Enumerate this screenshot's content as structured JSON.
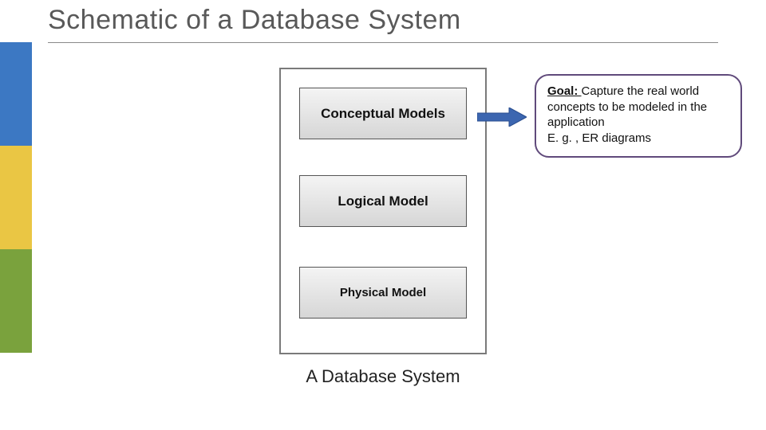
{
  "title": "Schematic of a Database System",
  "models": {
    "box1": "Conceptual Models",
    "box2": "Logical Model",
    "box3": "Physical Model"
  },
  "container_caption": "A Database System",
  "callout": {
    "goal_label": "Goal: ",
    "goal_text": "Capture the real world concepts to be modeled in the application",
    "example": "E. g. , ER diagrams"
  },
  "colors": {
    "sidebar_blue": "#3c78c3",
    "sidebar_yellow": "#eac644",
    "sidebar_green": "#7aa23d",
    "callout_border": "#604a7b",
    "arrow_fill": "#3c66b0"
  }
}
